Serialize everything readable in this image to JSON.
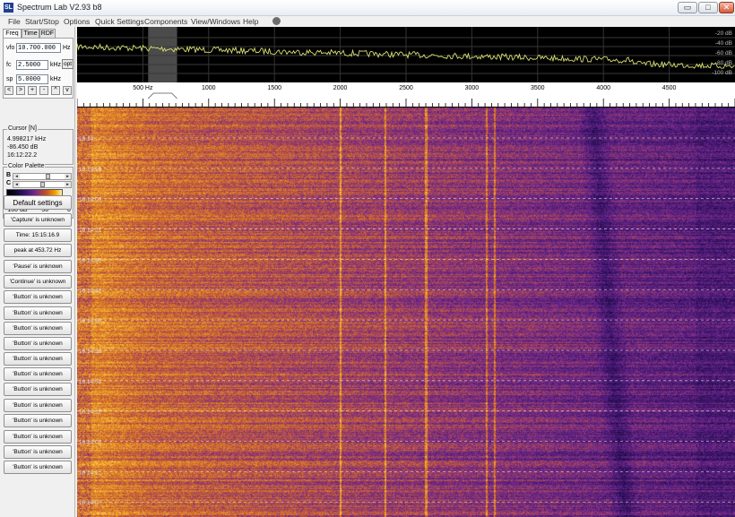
{
  "window": {
    "title": "Spectrum Lab V2.93 b8",
    "app_icon": "SL",
    "buttons": {
      "minimize": "▭",
      "maximize": "□",
      "close": "✕"
    }
  },
  "menu": [
    "File",
    "Start/Stop",
    "Options",
    "Quick Settings",
    "Components",
    "View/Windows",
    "Help"
  ],
  "tabs": [
    "Freq",
    "Time",
    "RDF"
  ],
  "freq": {
    "vfo_label": "vfo",
    "vfo_value": "10.700.000",
    "vfo_unit": "Hz",
    "fc_label": "fc",
    "fc_value": "2.5000",
    "fc_unit": "kHz",
    "sp_label": "sp",
    "sp_value": "5.0000",
    "sp_unit": "kHz",
    "opt_label": "opt",
    "step_buttons": [
      "<",
      ">",
      "+",
      "-",
      "^",
      "v"
    ]
  },
  "cursor": {
    "title": "Cursor [N]",
    "freq": "4.998217 kHz",
    "level": "-86.450 dB",
    "time": "16:12:22.2"
  },
  "palette": {
    "title": "Color Palette",
    "b_label": "B",
    "c_label": "C",
    "min": "-100 dB",
    "mid": "-50",
    "max": "0"
  },
  "buttons": [
    "Default settings",
    "'Capture' is unknown",
    "Time:  15:15:16.9",
    "peak at 453.72 Hz",
    "'Pause' is unknown",
    "'Continue' is unknown",
    "'Button' is unknown",
    "'Button' is unknown",
    "'Button' is unknown",
    "'Button' is unknown",
    "'Button' is unknown",
    "'Button' is unknown",
    "'Button' is unknown",
    "'Button' is unknown",
    "'Button' is unknown",
    "'Button' is unknown",
    "'Button' is unknown",
    "'Button' is unknown"
  ],
  "spectrum": {
    "db_labels": [
      "-20 dB",
      "-40 dB",
      "-60 dB",
      "-80 dB",
      "-100 dB"
    ],
    "trace_color": "#d8e070",
    "highlight_band_hz": [
      540,
      760
    ]
  },
  "freq_axis": {
    "min_hz": 0,
    "max_hz": 5000,
    "labels": [
      {
        "hz": 500,
        "text": "500  Hz"
      },
      {
        "hz": 1000,
        "text": "1000"
      },
      {
        "hz": 1500,
        "text": "1500"
      },
      {
        "hz": 2000,
        "text": "2000"
      },
      {
        "hz": 2500,
        "text": "2500"
      },
      {
        "hz": 3000,
        "text": "3000"
      },
      {
        "hz": 3500,
        "text": "3500"
      },
      {
        "hz": 4000,
        "text": "4000"
      },
      {
        "hz": 4500,
        "text": "4500"
      }
    ]
  },
  "waterfall": {
    "time_labels": [
      "16:14:...",
      "16:13:59",
      "16:14:09",
      "16:14:21",
      "16:14:30",
      "16:14:42",
      "16:14:50",
      "16:14:33",
      "16:14:52",
      "16:14:12",
      "16:14:02",
      "16:14:1...",
      "16:14:0..."
    ],
    "lines_hz": [
      2000,
      2340,
      2650,
      3110,
      3170
    ],
    "colors": {
      "low": "#2a0d55",
      "mid": "#7a2f8a",
      "high": "#e28a17",
      "peak": "#ffd24a"
    }
  }
}
